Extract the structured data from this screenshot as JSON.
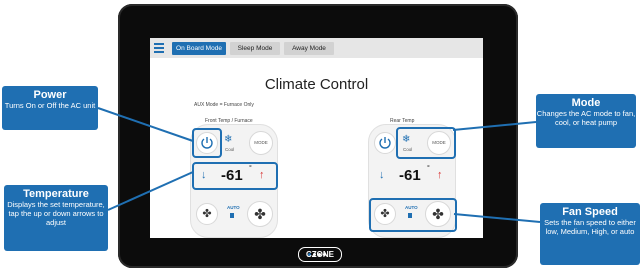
{
  "tabs": [
    {
      "label": "On Board Mode",
      "active": true
    },
    {
      "label": "Sleep Mode",
      "active": false
    },
    {
      "label": "Away Mode",
      "active": false
    }
  ],
  "screen": {
    "title": "Climate Control",
    "aux_note": "AUX Mode = Furnace Only",
    "front_label": "Front Temp / Furnace",
    "rear_label": "Rear Temp"
  },
  "front": {
    "mode": "Cool",
    "mode_btn": "MODE",
    "temp": "-61",
    "deg": "°",
    "fan": "AUTO"
  },
  "rear": {
    "mode": "Cool",
    "mode_btn": "MODE",
    "temp": "-61",
    "deg": "°",
    "fan": "AUTO"
  },
  "callouts": {
    "power": {
      "title": "Power",
      "desc": "Turns On or Off the AC unit"
    },
    "temperature": {
      "title": "Temperature",
      "desc": "Displays the set temperature, tap the up or down arrows to adjust"
    },
    "mode": {
      "title": "Mode",
      "desc": "Changes the AC mode to fan, cool, or heat pump"
    },
    "fan_speed": {
      "title": "Fan Speed",
      "desc": "Sets the fan speed to either low, Medium, High, or auto"
    }
  },
  "logo": "CZONE",
  "colors": {
    "accent": "#1f6fb2",
    "up_arrow": "#d83333",
    "bezel": "#0c0c0c"
  }
}
